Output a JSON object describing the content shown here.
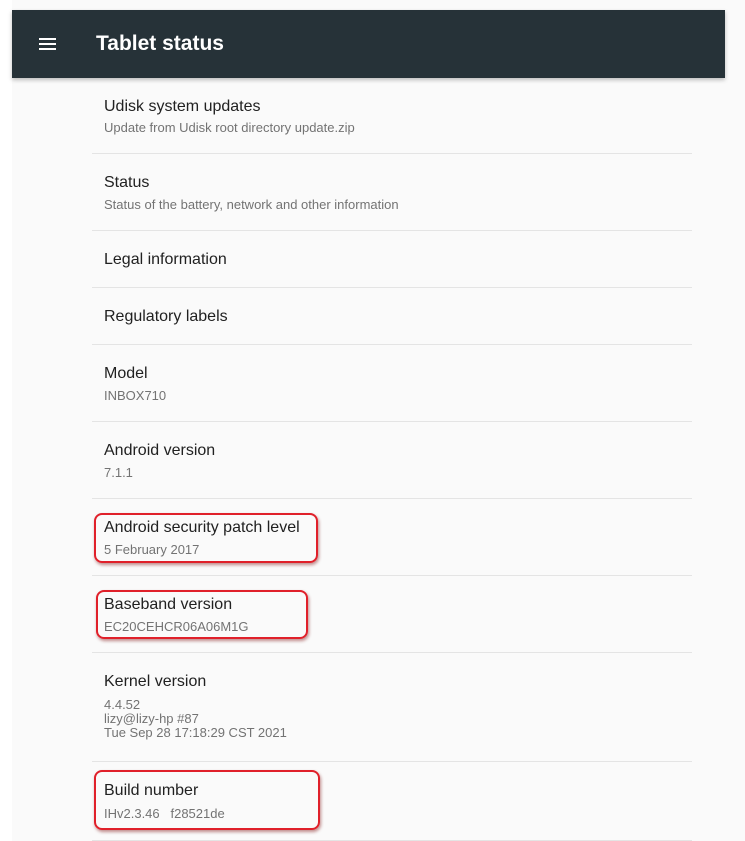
{
  "app_bar": {
    "title": "Tablet status",
    "menu_icon": "hamburger-menu-icon",
    "background": "#263238"
  },
  "preferences": [
    {
      "title": "Udisk system updates",
      "summary": "Update from Udisk root directory update.zip"
    },
    {
      "title": "Status",
      "summary": "Status of the battery, network and other information"
    },
    {
      "title": "Legal information"
    },
    {
      "title": "Regulatory labels"
    },
    {
      "title": "Model",
      "summary": "INBOX710"
    },
    {
      "title": "Android version",
      "summary": "7.1.1"
    },
    {
      "title": "Android security patch level",
      "summary": "5 February 2017"
    },
    {
      "title": "Baseband version",
      "summary": "EC20CEHCR06A06M1G"
    },
    {
      "title": "Kernel version",
      "summary_lines": [
        "4.4.52",
        "lizy@lizy-hp #87",
        "Tue Sep 28 17:18:29 CST 2021"
      ]
    },
    {
      "title": "Build number",
      "summary": "IHv2.3.46   f28521de"
    }
  ],
  "annotation_color": "#e0202a"
}
